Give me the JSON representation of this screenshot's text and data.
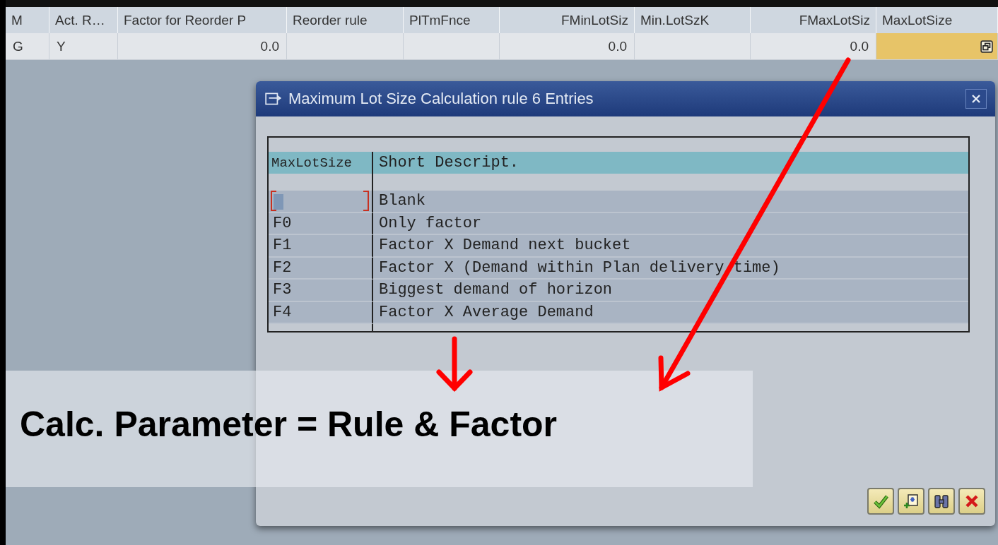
{
  "grid": {
    "columns": [
      {
        "label": "M"
      },
      {
        "label": "Act. R…"
      },
      {
        "label": "Factor for Reorder P"
      },
      {
        "label": "Reorder rule"
      },
      {
        "label": "PlTmFnce"
      },
      {
        "label": "FMinLotSiz"
      },
      {
        "label": "Min.LotSzK"
      },
      {
        "label": "FMaxLotSiz"
      },
      {
        "label": "MaxLotSize"
      }
    ],
    "rows": [
      {
        "cells": [
          {
            "kind": "text",
            "text": "G"
          },
          {
            "kind": "text",
            "text": "Y"
          },
          {
            "kind": "text",
            "text": "0.0"
          },
          {
            "kind": "text"
          },
          {
            "kind": "text"
          },
          {
            "kind": "text",
            "text": "0.0"
          },
          {
            "kind": "text"
          },
          {
            "kind": "text",
            "text": "0.0"
          },
          {
            "kind": "input",
            "selected": true
          }
        ]
      }
    ]
  },
  "dialog": {
    "title": "Maximum Lot Size Calculation rule 6 Entries",
    "columns": [
      "MaxLotSize",
      "Short Descript."
    ],
    "entries": [
      {
        "description": "Blank",
        "selected": true
      },
      {
        "key": "F0",
        "description": "Only factor",
        "selected": false
      },
      {
        "key": "F1",
        "description": "Factor X Demand next bucket",
        "selected": false
      },
      {
        "key": "F2",
        "description": "Factor X (Demand within Plan delivery time)",
        "selected": false
      },
      {
        "key": "F3",
        "description": "Biggest demand of horizon",
        "selected": false
      },
      {
        "key": "F4",
        "description": "Factor X Average Demand",
        "selected": false
      }
    ],
    "buttons": [
      {
        "kind": "confirm"
      },
      {
        "kind": "new"
      },
      {
        "kind": "find"
      },
      {
        "kind": "cancel"
      }
    ]
  },
  "annotation": "Calc. Parameter = Rule & Factor"
}
